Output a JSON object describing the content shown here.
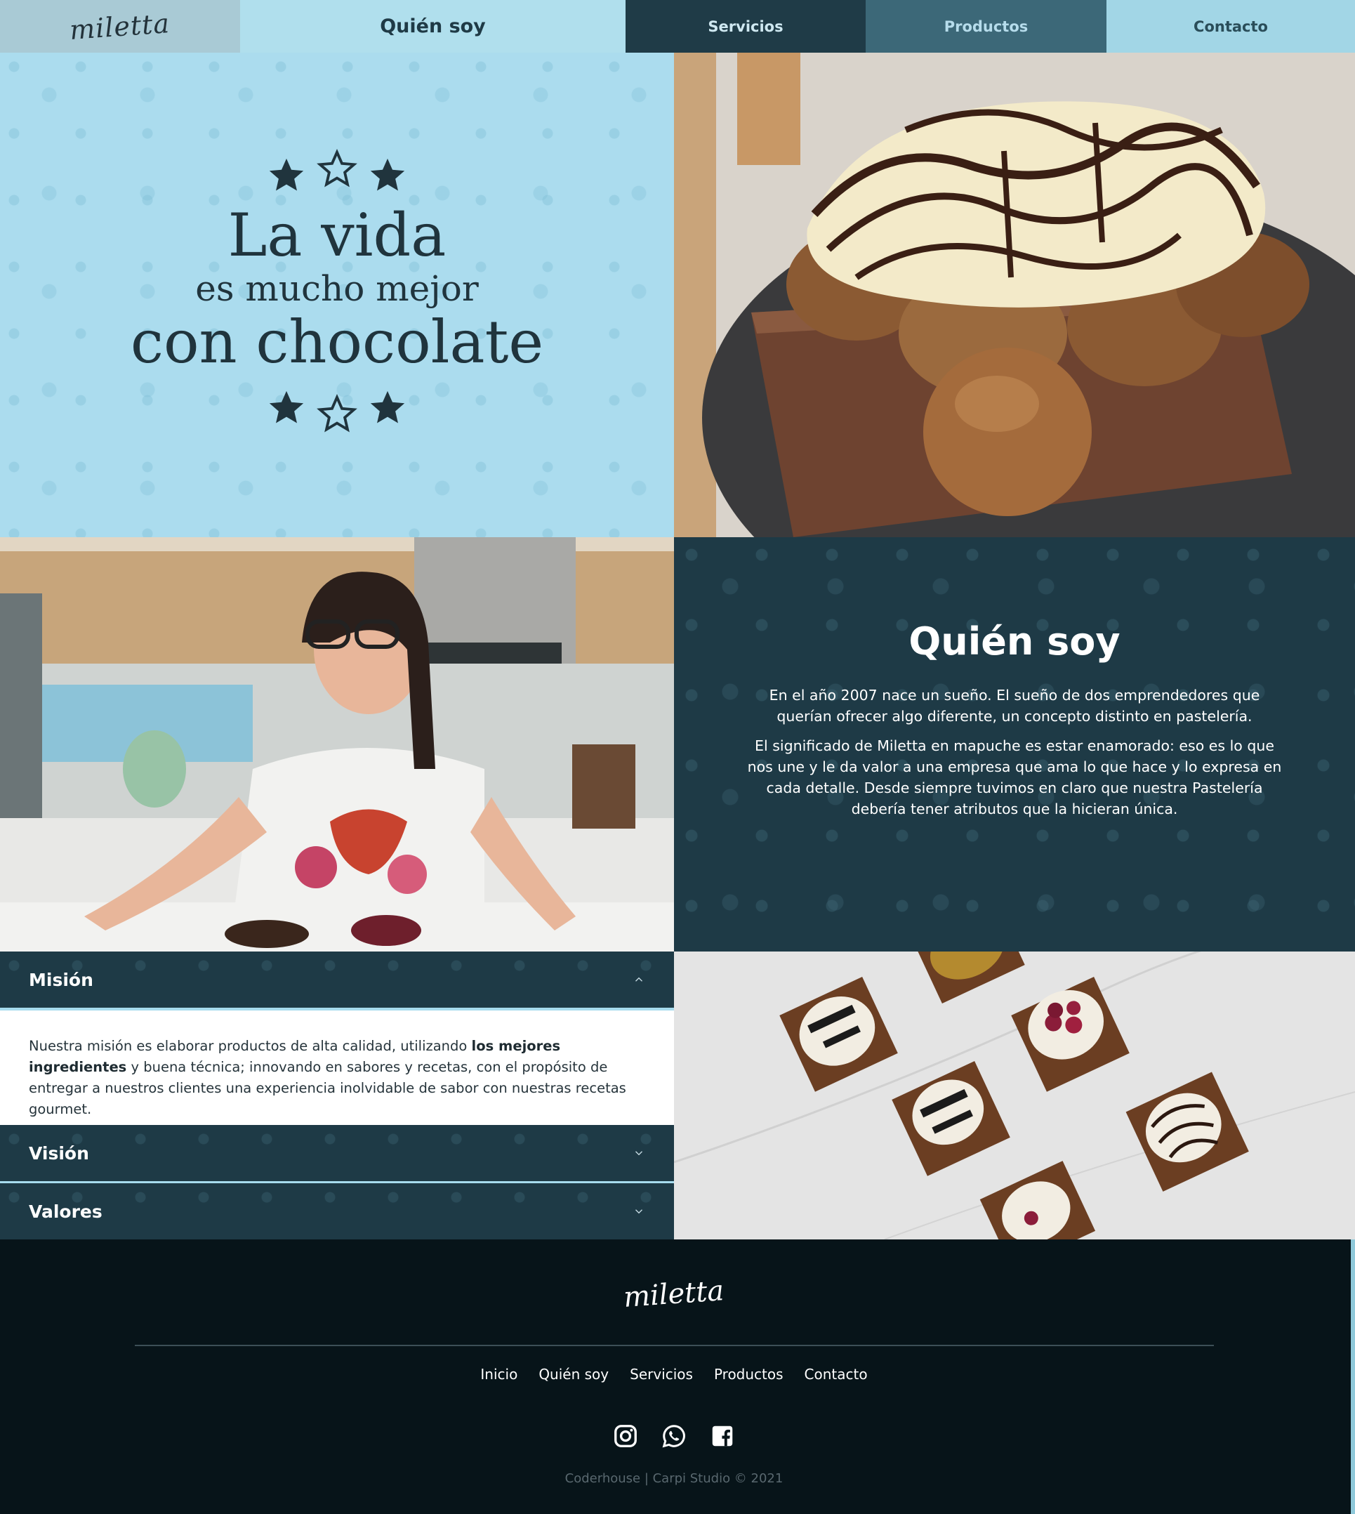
{
  "nav": {
    "logo": "miletta",
    "items": [
      {
        "label": "Quién soy"
      },
      {
        "label": "Servicios"
      },
      {
        "label": "Productos"
      },
      {
        "label": "Contacto"
      }
    ]
  },
  "hero": {
    "line1": "La vida",
    "line2": "es mucho mejor",
    "line3": "con chocolate"
  },
  "about": {
    "title": "Quién soy",
    "paragraph1": "En el año 2007 nace un sueño. El sueño de dos emprendedores que querían ofrecer algo diferente, un concepto distinto en pastelería.",
    "paragraph2": "El significado de Miletta en mapuche es estar enamorado: eso es lo que nos une y le da valor a una empresa que ama lo que hace y lo expresa en cada detalle. Desde siempre tuvimos en claro que nuestra Pastelería debería tener atributos que la hicieran única."
  },
  "accordion": {
    "items": [
      {
        "label": "Misión",
        "expanded": true
      },
      {
        "label": "Visión",
        "expanded": false
      },
      {
        "label": "Valores",
        "expanded": false
      }
    ],
    "mision_text_before": "Nuestra misión es elaborar productos de alta calidad, utilizando ",
    "mision_text_bold": "los mejores ingredientes",
    "mision_text_after": " y buena técnica; innovando en sabores y recetas, con el propósito de entregar a nuestros clientes una experiencia inolvidable de sabor con nuestras recetas gourmet."
  },
  "footer": {
    "logo": "miletta",
    "links": [
      {
        "label": "Inicio"
      },
      {
        "label": "Quién soy"
      },
      {
        "label": "Servicios"
      },
      {
        "label": "Productos"
      },
      {
        "label": "Contacto"
      }
    ],
    "social": [
      "instagram-icon",
      "whatsapp-icon",
      "facebook-icon"
    ],
    "copyright": "Coderhouse | Carpi Studio © 2021"
  },
  "colors": {
    "dark_teal": "#1e3a46",
    "light_blue": "#abdcee",
    "footer_bg": "#071419"
  }
}
